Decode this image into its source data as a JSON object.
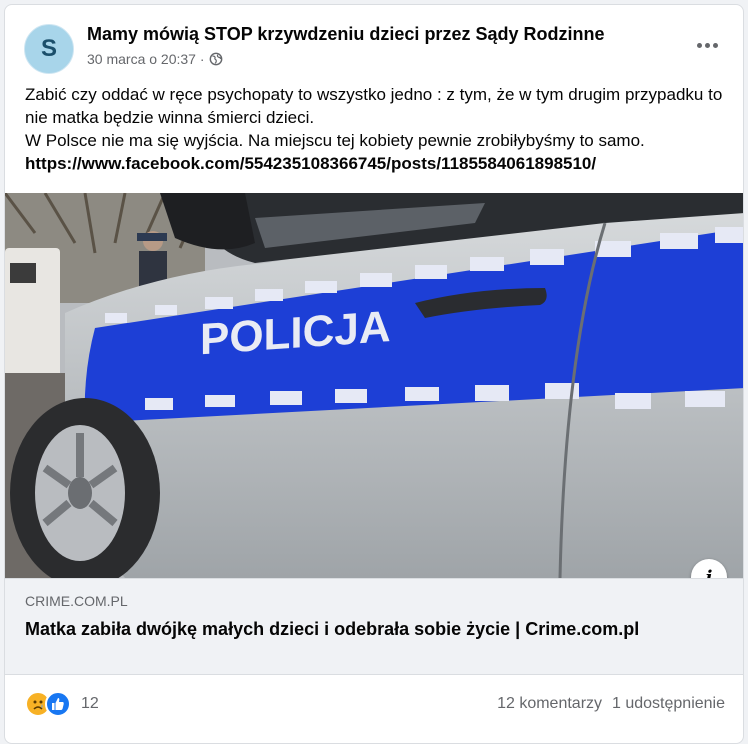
{
  "post": {
    "avatar_letter": "S",
    "page_name": "Mamy mówią STOP krzywdzeniu dzieci przez Sądy Rodzinne",
    "timestamp": "30 marca o 20:37 ·",
    "audience_icon": "globe-icon",
    "more_icon": "more-options-icon",
    "text_lines": [
      "Zabić czy oddać w ręce psychopaty to wszystko jedno : z tym, że w tym drugim przypadku to nie matka będzie winna śmierci dzieci.",
      "W Polsce nie ma się wyjścia. Na miejscu tej kobiety pewnie zrobiłybyśmy to samo."
    ],
    "link_text": "https://www.facebook.com/554235108366745/posts/1185584061898510/"
  },
  "image": {
    "car_lettering": "POLICJA",
    "info_icon": "i"
  },
  "link_preview": {
    "domain": "CRIME.COM.PL",
    "title": "Matka zabiła dwójkę małych dzieci i odebrała sobie życie | Crime.com.pl"
  },
  "footer": {
    "reaction_icons": [
      "sad-icon",
      "like-icon"
    ],
    "reaction_count": "12",
    "comments": "12 komentarzy",
    "shares": "1 udostępnienie"
  },
  "colors": {
    "accent": "#1877f2",
    "police_blue": "#1d3fd6",
    "sad_reaction": "#f7b125"
  }
}
